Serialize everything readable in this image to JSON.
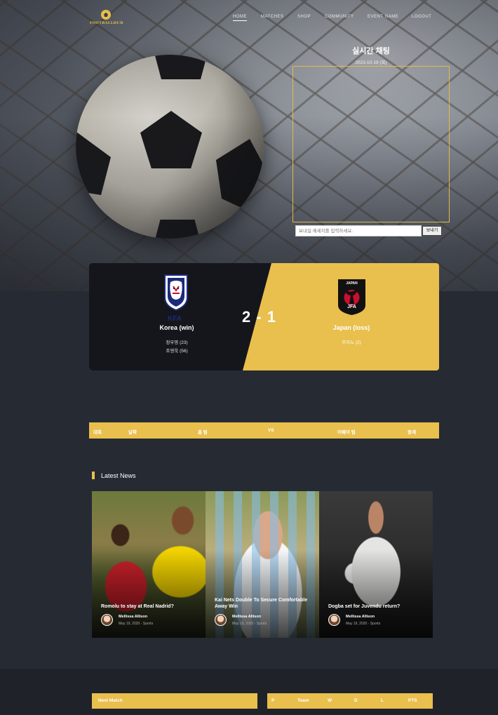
{
  "brand": {
    "logo_text": "FOOTBALLHUB"
  },
  "nav": {
    "items": [
      "HOME",
      "MATCHES",
      "SHOP",
      "COMMUNITY",
      "EVENT GAME",
      "LOGOUT"
    ],
    "active": "HOME"
  },
  "chat": {
    "title": "실시간 채팅",
    "date": "2023-10-19 (목)",
    "placeholder": "보내실 메세지를 입력하세요.",
    "send_label": "보내기"
  },
  "match": {
    "home": {
      "name": "Korea (win)",
      "logo_text": "KFA",
      "scorers": [
        "정우영 (23)",
        "조영욱 (56)"
      ]
    },
    "away": {
      "name": "Japan (loss)",
      "logo_text": "JAPAN",
      "logo_sub": "JFA",
      "scorers": [
        "무지노 (2)"
      ]
    },
    "score": "2 - 1"
  },
  "schedule": {
    "columns": [
      "대회",
      "날짜",
      "홈 팀",
      "VS",
      "어웨이 팀",
      "중계"
    ]
  },
  "news": {
    "heading": "Latest News",
    "items": [
      {
        "title": "Romolu to stay at Real Nadrid?",
        "author": "Mellissa Allison",
        "meta": "May 19, 2020 - Sports"
      },
      {
        "title": "Kai Nets Double To Secure Comfortable Away Win",
        "author": "Mellissa Allison",
        "meta": "May 19, 2020 - Sports"
      },
      {
        "title": "Dogba set for Juvendu return?",
        "author": "Mellissa Allison",
        "meta": "May 19, 2020 - Sports"
      }
    ]
  },
  "next_match": {
    "label": "Next Match"
  },
  "standings": {
    "columns": [
      "P",
      "Team",
      "W",
      "D",
      "L",
      "PTS"
    ]
  },
  "colors": {
    "accent": "#e9bf4d",
    "dark_panel": "#15161c",
    "page_bg": "#262a33"
  }
}
